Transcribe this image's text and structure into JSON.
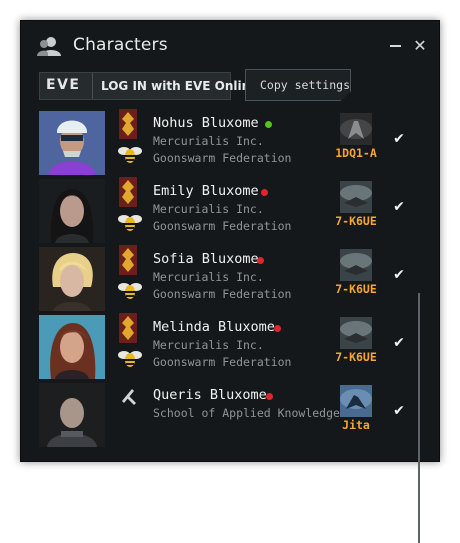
{
  "window": {
    "title": "Characters",
    "title_icon": "characters-icon"
  },
  "toolbar": {
    "eve_logo_text": "EVE",
    "login_label": "LOG IN with EVE Online",
    "copy_label": "Copy settings"
  },
  "characters": [
    {
      "name": "Nohus Bluxome",
      "status": "online",
      "status_color": "#52c41a",
      "corporation": "Mercurialis Inc.",
      "alliance": "Goonswarm Federation",
      "system": "1DQ1-A"
    },
    {
      "name": "Emily Bluxome",
      "status": "offline",
      "status_color": "#e0262a",
      "corporation": "Mercurialis Inc.",
      "alliance": "Goonswarm Federation",
      "system": "7-K6UE"
    },
    {
      "name": "Sofia Bluxome",
      "status": "offline",
      "status_color": "#e0262a",
      "corporation": "Mercurialis Inc.",
      "alliance": "Goonswarm Federation",
      "system": "7-K6UE"
    },
    {
      "name": "Melinda Bluxome",
      "status": "offline",
      "status_color": "#e0262a",
      "corporation": "Mercurialis Inc.",
      "alliance": "Goonswarm Federation",
      "system": "7-K6UE"
    },
    {
      "name": "Queris Bluxome",
      "status": "offline",
      "status_color": "#e0262a",
      "corporation": "School of Applied Knowledge",
      "alliance": "",
      "system": "Jita"
    }
  ],
  "icons": {
    "check": "check-icon",
    "minimize": "minimize-icon",
    "close": "close-icon"
  },
  "colors": {
    "window_bg": "#15181a",
    "system_text": "#f4a632",
    "online": "#52c41a",
    "offline": "#e0262a"
  }
}
